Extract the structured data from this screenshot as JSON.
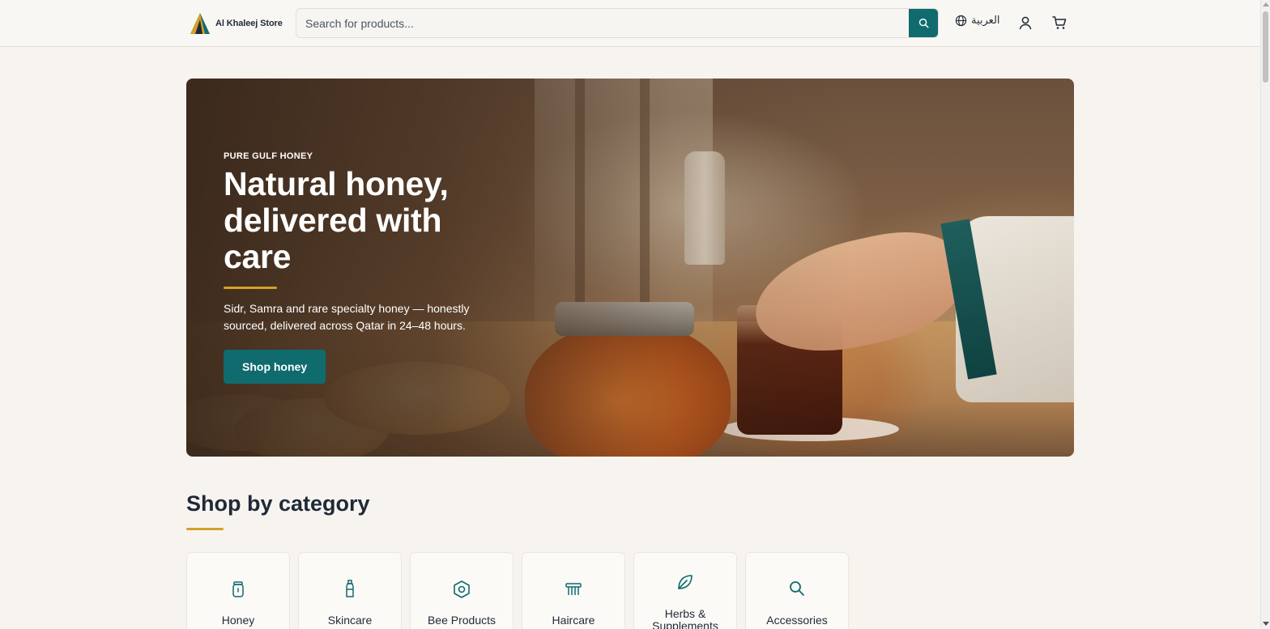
{
  "colors": {
    "accent": "#0f6b6e",
    "gold": "#d4a02a",
    "background": "#f7f4f0"
  },
  "header": {
    "logo_text": "Al Khaleej Store",
    "search": {
      "placeholder": "Search for products...",
      "value": ""
    },
    "language_label": "العربية",
    "icons": [
      "logo-mark",
      "search-icon",
      "globe-icon",
      "user-icon",
      "cart-icon"
    ]
  },
  "hero": {
    "eyebrow": "PURE GULF HONEY",
    "title": "Natural honey, delivered with care",
    "description": "Sidr, Samra and rare specialty honey — honestly sourced, delivered across Qatar in 24–48 hours.",
    "cta_label": "Shop honey"
  },
  "categories": {
    "title": "Shop by category",
    "items": [
      {
        "label": "Honey",
        "icon": "jar-icon"
      },
      {
        "label": "Skincare",
        "icon": "bottle-icon"
      },
      {
        "label": "Bee Products",
        "icon": "hexagon-icon"
      },
      {
        "label": "Haircare",
        "icon": "comb-icon"
      },
      {
        "label": "Herbs & Supplements",
        "icon": "leaf-icon"
      },
      {
        "label": "Accessories",
        "icon": "search-icon"
      }
    ]
  }
}
